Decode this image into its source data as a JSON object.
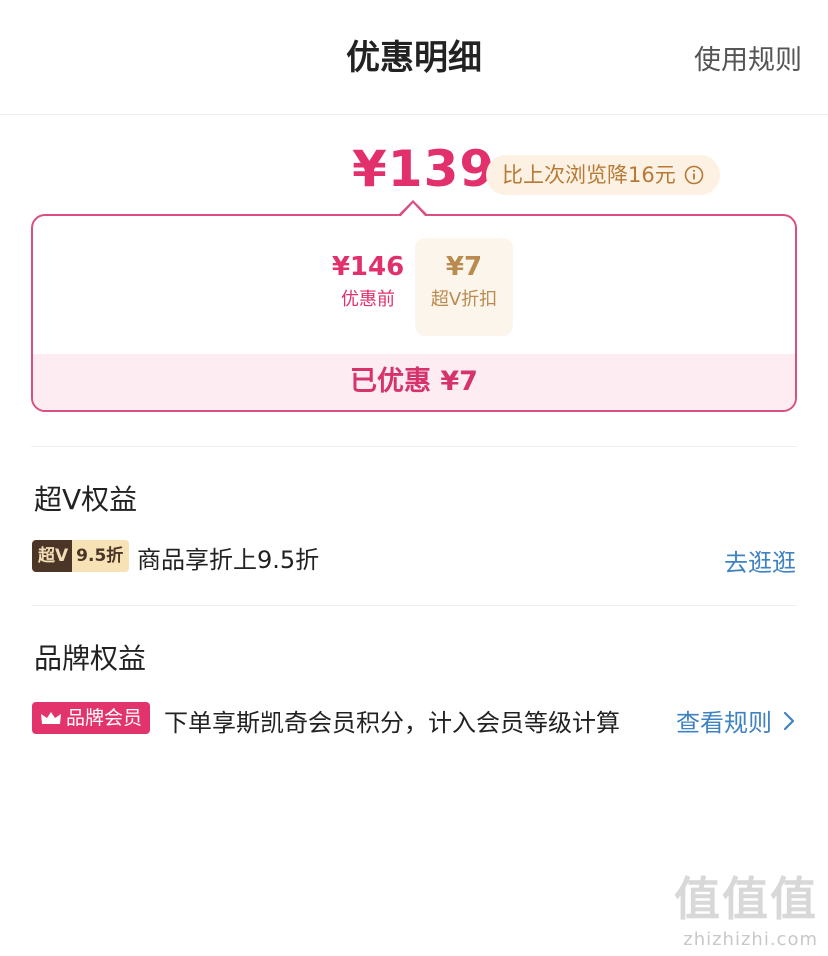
{
  "header": {
    "title": "优惠明细",
    "rules_link": "使用规则"
  },
  "price": {
    "final": "¥139",
    "compare_badge": "比上次浏览降16元",
    "info_icon": "info-circle-icon"
  },
  "breakdown": {
    "original_price": "¥146",
    "original_label": "优惠前",
    "minus": "-",
    "discount_amount": "¥7",
    "discount_label": "超V折扣",
    "saved_text": "已优惠 ¥7"
  },
  "super_v": {
    "section_title": "超V权益",
    "badge_left": "超V",
    "badge_right": "9.5折",
    "benefit": "商品享折上9.5折",
    "link": "去逛逛"
  },
  "brand": {
    "section_title": "品牌权益",
    "badge": "品牌会员",
    "badge_icon": "crown-icon",
    "benefit": "下单享斯凯奇会员积分，计入会员等级计算",
    "link": "查看规则",
    "link_icon": "chevron-right-icon"
  },
  "watermark": {
    "glyphs": "值值值",
    "url": "zhizhizhi.com"
  },
  "colors": {
    "accent_pink": "#e1306c",
    "gold": "#bb8a4e",
    "link_blue": "#3f82c2"
  }
}
